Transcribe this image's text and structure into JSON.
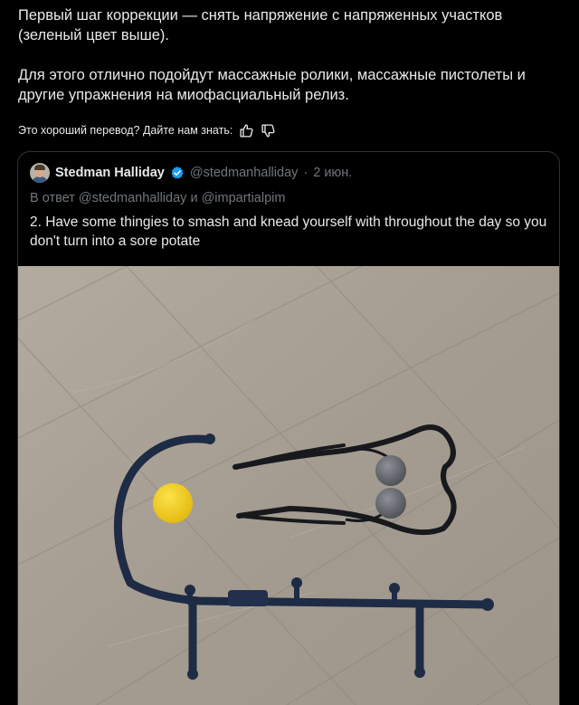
{
  "translation": {
    "paragraph1": "Первый шаг коррекции — снять напряжение с напряженных участков (зеленый цвет выше).",
    "paragraph2": "Для этого отлично подойдут массажные ролики, массажные пистолеты и другие упражнения на миофасциальный релиз."
  },
  "feedback": {
    "prompt": "Это хороший перевод? Дайте нам знать:",
    "like_icon": "thumbs-up-icon",
    "dislike_icon": "thumbs-down-icon"
  },
  "quoted_tweet": {
    "author_name": "Stedman Halliday",
    "verified_icon": "verified-badge-icon",
    "verified_color": "#1d9bf0",
    "handle": "@stedmanhalliday",
    "separator": "·",
    "date": "2 июн.",
    "reply_prefix": "В ответ",
    "reply_mention_1": "@stedmanhalliday",
    "reply_and": "и",
    "reply_mention_2": "@impartialpim",
    "text": "2. Have some thingies to smash and knead yourself with throughout the day so you don't turn into a sore potate"
  },
  "colors": {
    "background": "#000000",
    "text": "#e7e9ea",
    "muted": "#71767b",
    "border": "#2f3336"
  }
}
